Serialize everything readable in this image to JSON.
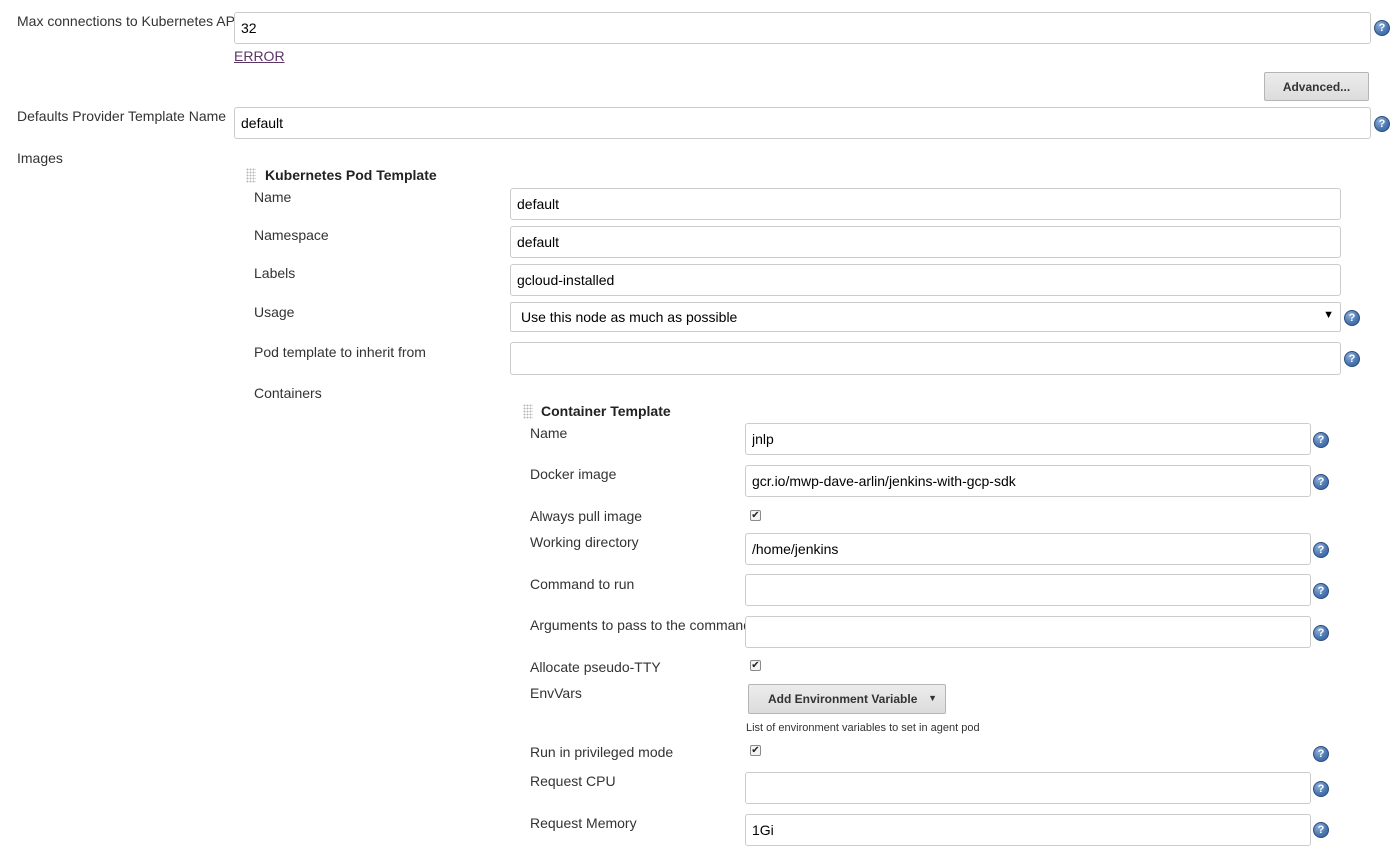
{
  "top": {
    "max_connections": {
      "label": "Max connections to Kubernetes API",
      "value": "32",
      "error": "ERROR"
    },
    "advanced_button": "Advanced...",
    "defaults_provider": {
      "label": "Defaults Provider Template Name",
      "value": "default"
    },
    "images_label": "Images"
  },
  "pod_template": {
    "title": "Kubernetes Pod Template",
    "name": {
      "label": "Name",
      "value": "default"
    },
    "namespace": {
      "label": "Namespace",
      "value": "default"
    },
    "labels": {
      "label": "Labels",
      "value": "gcloud-installed"
    },
    "usage": {
      "label": "Usage",
      "value": "Use this node as much as possible"
    },
    "inherit_from": {
      "label": "Pod template to inherit from",
      "value": ""
    },
    "containers_label": "Containers"
  },
  "container_template": {
    "title": "Container Template",
    "name": {
      "label": "Name",
      "value": "jnlp"
    },
    "docker_image": {
      "label": "Docker image",
      "value": "gcr.io/mwp-dave-arlin/jenkins-with-gcp-sdk"
    },
    "always_pull": {
      "label": "Always pull image",
      "checked": true
    },
    "working_dir": {
      "label": "Working directory",
      "value": "/home/jenkins"
    },
    "command": {
      "label": "Command to run",
      "value": ""
    },
    "arguments": {
      "label": "Arguments to pass to the command",
      "value": ""
    },
    "tty": {
      "label": "Allocate pseudo-TTY",
      "checked": true
    },
    "envvars": {
      "label": "EnvVars",
      "button": "Add Environment Variable",
      "description": "List of environment variables to set in agent pod"
    },
    "privileged": {
      "label": "Run in privileged mode",
      "checked": true
    },
    "request_cpu": {
      "label": "Request CPU",
      "value": ""
    },
    "request_memory": {
      "label": "Request Memory",
      "value": "1Gi"
    }
  },
  "icons": {
    "help": "help-icon",
    "grip": "drag-handle-icon",
    "check": "checkmark-icon",
    "dropdown": "caret-down-icon"
  },
  "glyphs": {
    "help": "?",
    "check": "✔",
    "caret": "▼"
  },
  "colors": {
    "help_icon": "#4d78b3",
    "error_link": "#5c3566",
    "button_bg": "#dcdcdc"
  }
}
